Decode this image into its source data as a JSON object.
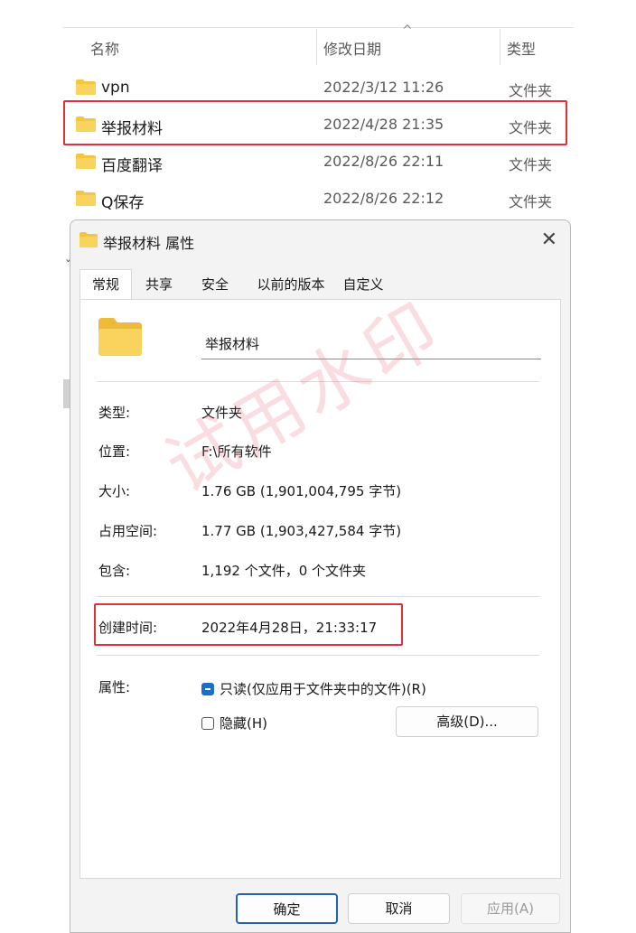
{
  "explorer": {
    "columns": {
      "name": "名称",
      "date": "修改日期",
      "type": "类型"
    },
    "sort_caret": "^",
    "rows": [
      {
        "name": "vpn",
        "date": "2022/3/12 11:26",
        "type": "文件夹"
      },
      {
        "name": "举报材料",
        "date": "2022/4/28 21:35",
        "type": "文件夹"
      },
      {
        "name": "百度翻译",
        "date": "2022/8/26 22:11",
        "type": "文件夹"
      },
      {
        "name": "Q保存",
        "date": "2022/8/26 22:12",
        "type": "文件夹"
      }
    ],
    "highlighted_row": 1
  },
  "dialog": {
    "title": "举报材料 属性",
    "close": "✕",
    "tabs": [
      "常规",
      "共享",
      "安全",
      "以前的版本",
      "自定义"
    ],
    "active_tab": "常规",
    "folder_name": "举报材料",
    "props": {
      "type_label": "类型:",
      "type_value": "文件夹",
      "location_label": "位置:",
      "location_value": "F:\\所有软件",
      "size_label": "大小:",
      "size_value": "1.76 GB (1,901,004,795 字节)",
      "disk_label": "占用空间:",
      "disk_value": "1.77 GB (1,903,427,584 字节)",
      "contains_label": "包含:",
      "contains_value": "1,192 个文件，0 个文件夹",
      "created_label": "创建时间:",
      "created_value": "2022年4月28日，21:33:17",
      "attributes_label": "属性:"
    },
    "attributes": {
      "readonly_label": "只读(仅应用于文件夹中的文件)(R)",
      "readonly_state": "partial",
      "hidden_label": "隐藏(H)",
      "hidden_state": "unchecked",
      "advanced_button": "高级(D)..."
    },
    "buttons": {
      "ok": "确定",
      "cancel": "取消",
      "apply": "应用(A)"
    },
    "watermark": "试用水印"
  },
  "colors": {
    "highlight": "#e0303a",
    "folder": "#f5c542",
    "accent": "#1a6fc9"
  }
}
